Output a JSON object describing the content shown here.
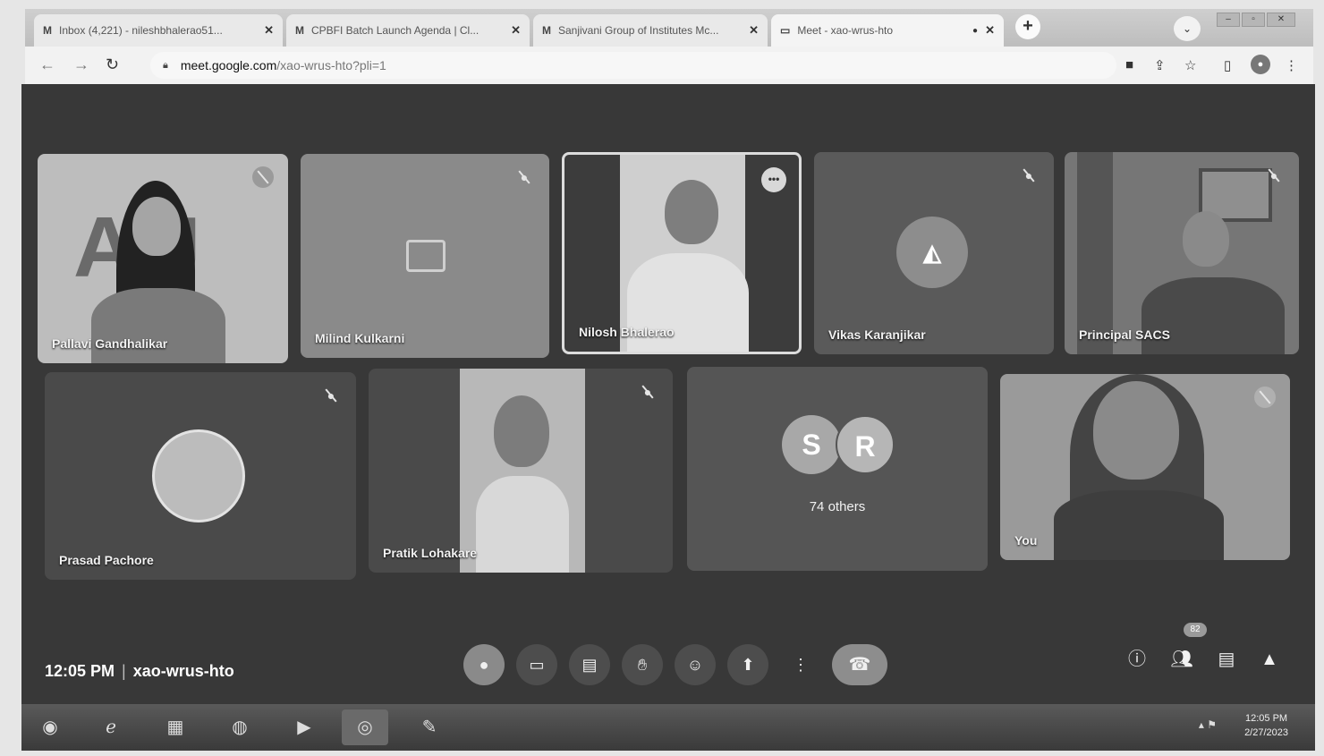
{
  "browser": {
    "tabs": [
      {
        "favicon": "M",
        "title": "Inbox (4,221) - nileshbhalerao51...",
        "close": "✕",
        "active": false
      },
      {
        "favicon": "M",
        "title": "CPBFI Batch Launch Agenda | Cl...",
        "close": "✕",
        "active": false
      },
      {
        "favicon": "M",
        "title": "Sanjivani Group of Institutes Mc...",
        "close": "✕",
        "active": false
      },
      {
        "favicon": "▭",
        "title": "Meet - xao-wrus-hto",
        "recording": "●",
        "close": "✕",
        "active": true
      }
    ],
    "new_tab": "+",
    "tab_search": "⌄",
    "url_host": "meet.google.com",
    "url_path": "/xao-wrus-hto?pli=1"
  },
  "meet": {
    "participants": [
      {
        "name": "Pallavi Gandhalikar"
      },
      {
        "name": "Milind Kulkarni"
      },
      {
        "name": "Nilosh Bhalerao"
      },
      {
        "name": "Vikas Karanjikar"
      },
      {
        "name": "Principal SACS"
      },
      {
        "name": "Prasad Pachore"
      },
      {
        "name": "Pratik Lohakare"
      },
      {
        "name": "You"
      }
    ],
    "others": {
      "initials": [
        "S",
        "R"
      ],
      "label": "74 others"
    },
    "time": "12:05 PM",
    "separator": "|",
    "code": "xao-wrus-hto",
    "participant_count": "82"
  },
  "taskbar": {
    "time": "12:05 PM",
    "date": "2/27/2023"
  }
}
